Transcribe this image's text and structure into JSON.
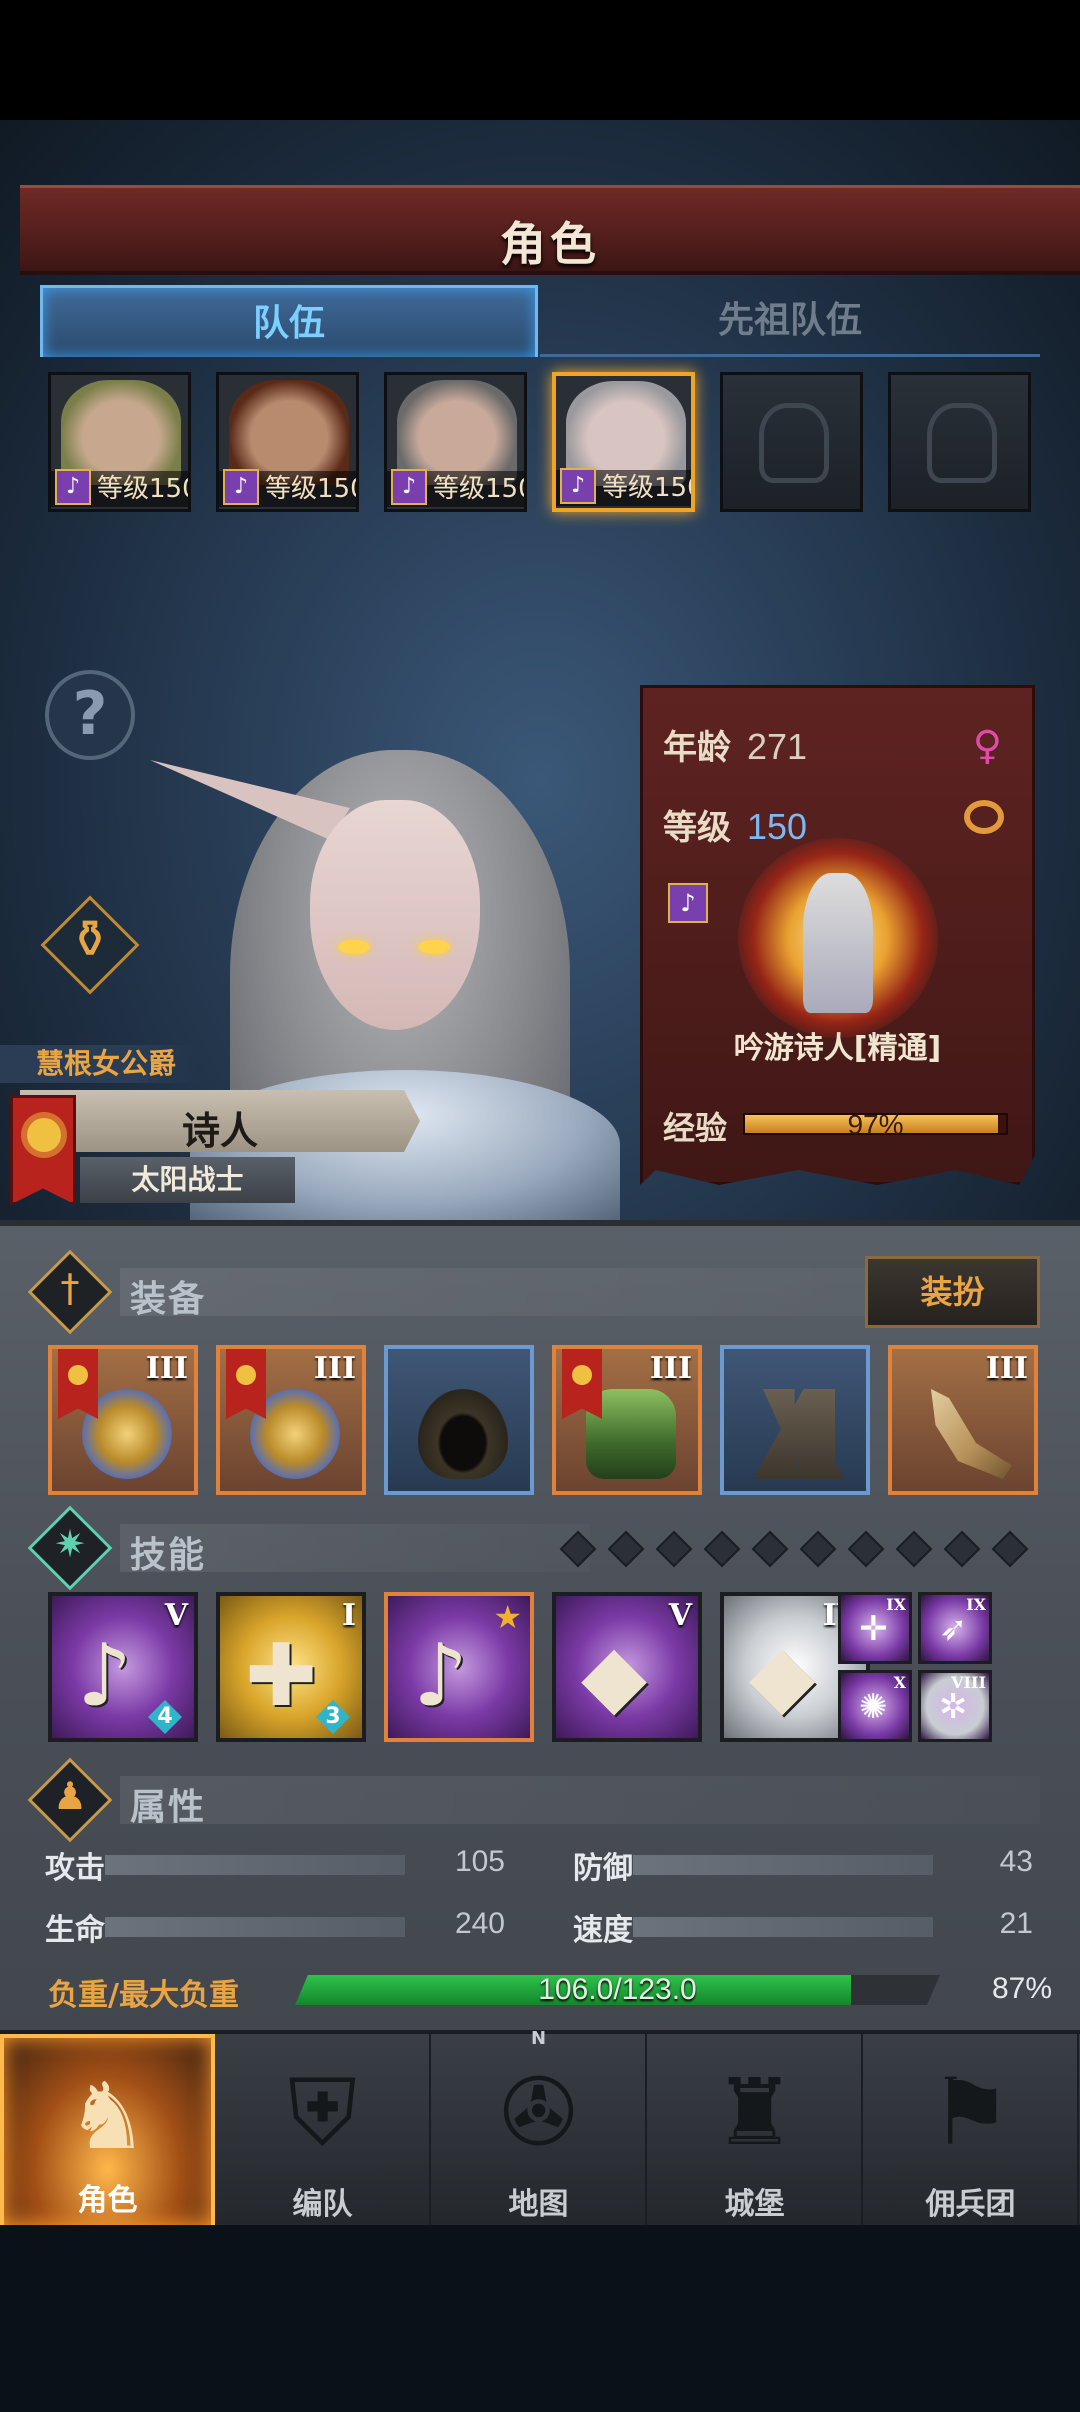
{
  "header": {
    "title": "角色"
  },
  "tabs": [
    {
      "label": "队伍",
      "active": true
    },
    {
      "label": "先祖队伍",
      "active": false
    }
  ],
  "roster": [
    {
      "level_text": "等级150",
      "skin": "#c7a88e",
      "hair": "#7a7f4a",
      "selected": false,
      "empty": false
    },
    {
      "level_text": "等级150",
      "skin": "#b88a6e",
      "hair": "#5a2a18",
      "selected": false,
      "empty": false
    },
    {
      "level_text": "等级150",
      "skin": "#c8a99a",
      "hair": "#6a6a6a",
      "selected": false,
      "empty": false
    },
    {
      "level_text": "等级150",
      "skin": "#d8c4c0",
      "hair": "#9a9a9e",
      "selected": true,
      "empty": false
    },
    {
      "level_text": "",
      "empty": true
    },
    {
      "level_text": "",
      "empty": true
    }
  ],
  "character": {
    "title": "慧根女公爵",
    "class_name": "诗人",
    "faction": "太阳战士"
  },
  "info": {
    "age_label": "年龄",
    "age": "271",
    "level_label": "等级",
    "level": "150",
    "job_name": "吟游诗人[精通]",
    "exp_label": "经验",
    "exp_text": "97%",
    "exp_fraction": 0.97
  },
  "equipment": {
    "label": "装备",
    "dress_button": "装扮",
    "items": [
      {
        "tier": "III",
        "faction_flag": true,
        "rarity": "orange",
        "icon": "ornate-shield-icon"
      },
      {
        "tier": "III",
        "faction_flag": true,
        "rarity": "orange",
        "icon": "ornate-shield-icon"
      },
      {
        "tier": "",
        "faction_flag": false,
        "rarity": "blue",
        "icon": "hood-icon"
      },
      {
        "tier": "III",
        "faction_flag": true,
        "rarity": "orange",
        "icon": "armor-icon"
      },
      {
        "tier": "",
        "faction_flag": false,
        "rarity": "blue",
        "icon": "boots-icon"
      },
      {
        "tier": "III",
        "faction_flag": false,
        "rarity": "orange",
        "icon": "horn-icon"
      }
    ]
  },
  "skills": {
    "label": "技能",
    "dot_count": 10,
    "items": [
      {
        "tier": "V",
        "rank": "4",
        "color": "purple",
        "icon": "music-note-icon",
        "glyph": "♪",
        "selected": false,
        "star": false
      },
      {
        "tier": "I",
        "rank": "3",
        "color": "gold",
        "icon": "shield-heal-icon",
        "glyph": "✚",
        "selected": false,
        "star": false
      },
      {
        "tier": "",
        "rank": "",
        "color": "purple",
        "icon": "crystal-note-icon",
        "glyph": "♪",
        "selected": true,
        "star": true
      },
      {
        "tier": "V",
        "rank": "",
        "color": "purple",
        "icon": "crystal-hand-icon",
        "glyph": "◆",
        "selected": false,
        "star": false
      },
      {
        "tier": "IV",
        "rank": "",
        "color": "white",
        "icon": "crystal-hand-icon",
        "glyph": "◆",
        "selected": false,
        "star": false
      }
    ],
    "mini": [
      {
        "tier": "IX",
        "icon": "target-icon",
        "glyph": "✛"
      },
      {
        "tier": "IX",
        "icon": "spear-icon",
        "glyph": "➶"
      },
      {
        "tier": "X",
        "icon": "burst-icon",
        "glyph": "✺"
      },
      {
        "tier": "VIII",
        "icon": "frost-icon",
        "glyph": "✲"
      }
    ]
  },
  "attributes": {
    "label": "属性",
    "stats": [
      {
        "name": "攻击",
        "value": "105"
      },
      {
        "name": "防御",
        "value": "43"
      },
      {
        "name": "生命",
        "value": "240"
      },
      {
        "name": "速度",
        "value": "21"
      }
    ],
    "weight_label": "负重/最大负重",
    "weight_text": "106.0/123.0",
    "weight_fraction": 0.862,
    "weight_pct": "87%"
  },
  "nav": [
    {
      "label": "角色",
      "icon": "knight-icon",
      "glyph": "♞",
      "active": true
    },
    {
      "label": "编队",
      "icon": "helmet-icon",
      "glyph": "⛨",
      "active": false
    },
    {
      "label": "地图",
      "icon": "compass-icon",
      "glyph": "✇",
      "active": false,
      "compass": "N"
    },
    {
      "label": "城堡",
      "icon": "castle-icon",
      "glyph": "♜",
      "active": false
    },
    {
      "label": "佣兵团",
      "icon": "banner-icon",
      "glyph": "⚑",
      "active": false
    }
  ],
  "colors": {
    "accent_gold": "#e9a443",
    "level_blue": "#7db8f0",
    "female_pink": "#e04aa8",
    "exp_fill": "#f6c45a",
    "weight_fill": "#2ec24a"
  }
}
